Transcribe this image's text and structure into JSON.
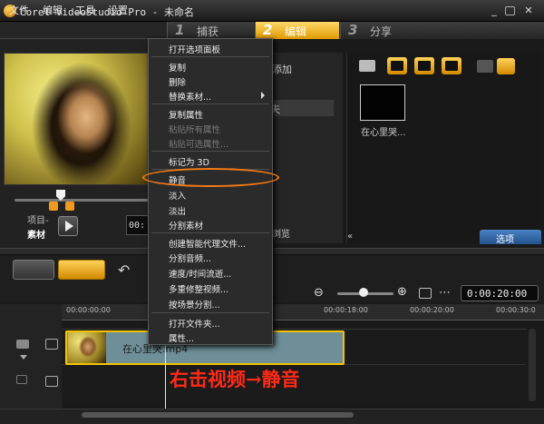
{
  "app": {
    "title": "Corel VideoStudio Pro - 未命名",
    "win_min": "_",
    "win_close": "✕"
  },
  "menubar": [
    "文件",
    "编辑",
    "工具",
    "设置"
  ],
  "steps": [
    {
      "num": "1",
      "label": "捕获"
    },
    {
      "num": "2",
      "label": "编辑"
    },
    {
      "num": "3",
      "label": "分享"
    }
  ],
  "preview": {
    "project_label": "项目-",
    "clip_label": "素材",
    "timecode_partial": "00:"
  },
  "options_partial": {
    "add": "添加",
    "fu": "夫",
    "browse": "浏览"
  },
  "library": {
    "thumb_caption": "在心里哭...",
    "options_tab": "选项",
    "collapse": "«"
  },
  "timeline": {
    "ruler": [
      "00:00:00:00",
      "00:00:18:00",
      "00:00:20:00",
      "00:00:30:0"
    ],
    "clip_name": "在心里哭.mp4",
    "timecode": "0:00:20:00",
    "zoom_out": "⊖",
    "zoom_in": "⊕",
    "undo": "↶",
    "more": "⋯"
  },
  "context_menu": {
    "items": [
      {
        "label": "打开选项面板",
        "enabled": true
      },
      {
        "label": "复制",
        "enabled": true
      },
      {
        "label": "删除",
        "enabled": true
      },
      {
        "label": "替换素材...",
        "enabled": true,
        "submenu": true
      },
      {
        "label": "复制属性",
        "enabled": true
      },
      {
        "label": "粘贴所有属性",
        "enabled": false
      },
      {
        "label": "粘贴可选属性...",
        "enabled": false
      },
      {
        "label": "标记为 3D",
        "enabled": true
      },
      {
        "label": "静音",
        "enabled": true,
        "highlighted": true
      },
      {
        "label": "淡入",
        "enabled": true
      },
      {
        "label": "淡出",
        "enabled": true
      },
      {
        "label": "分割素材",
        "enabled": true
      },
      {
        "label": "创建智能代理文件...",
        "enabled": true
      },
      {
        "label": "分割音频...",
        "enabled": true
      },
      {
        "label": "速度/时间流逝...",
        "enabled": true
      },
      {
        "label": "多重修整视频...",
        "enabled": true
      },
      {
        "label": "按场景分割...",
        "enabled": true
      },
      {
        "label": "打开文件夹...",
        "enabled": true
      },
      {
        "label": "属性...",
        "enabled": true
      }
    ]
  },
  "annotation": "右击视频→静音",
  "colors": {
    "accent": "#f47b16",
    "annotation": "#ff2a17",
    "tab_active": "#ffd86a"
  }
}
